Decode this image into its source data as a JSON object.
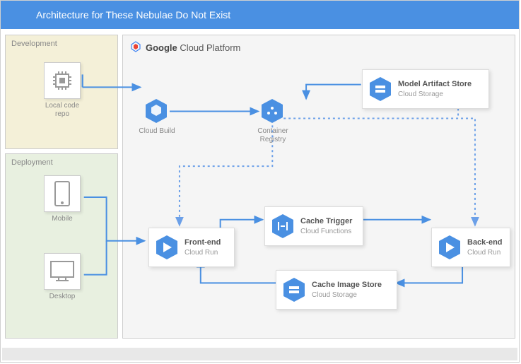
{
  "titlebar": "Architecture for These Nebulae Do Not Exist",
  "zones": {
    "development": {
      "label": "Development"
    },
    "deployment": {
      "label": "Deployment"
    },
    "gcp": {
      "brand_bold": "Google",
      "brand_rest": " Cloud Platform"
    }
  },
  "dev_items": {
    "local_repo": "Local code repo"
  },
  "dep_items": {
    "mobile": "Mobile",
    "desktop": "Desktop"
  },
  "gcp_nodes": {
    "cloud_build": "Cloud Build",
    "container_registry": "Container Registry"
  },
  "cards": {
    "model_store": {
      "title": "Model Artifact Store",
      "sub": "Cloud Storage"
    },
    "frontend": {
      "title": "Front-end",
      "sub": "Cloud Run"
    },
    "backend": {
      "title": "Back-end",
      "sub": "Cloud Run"
    },
    "cache_trigger": {
      "title": "Cache Trigger",
      "sub": "Cloud Functions"
    },
    "cache_image": {
      "title": "Cache Image Store",
      "sub": "Cloud Storage"
    }
  },
  "colors": {
    "accent": "#4a90e2"
  }
}
